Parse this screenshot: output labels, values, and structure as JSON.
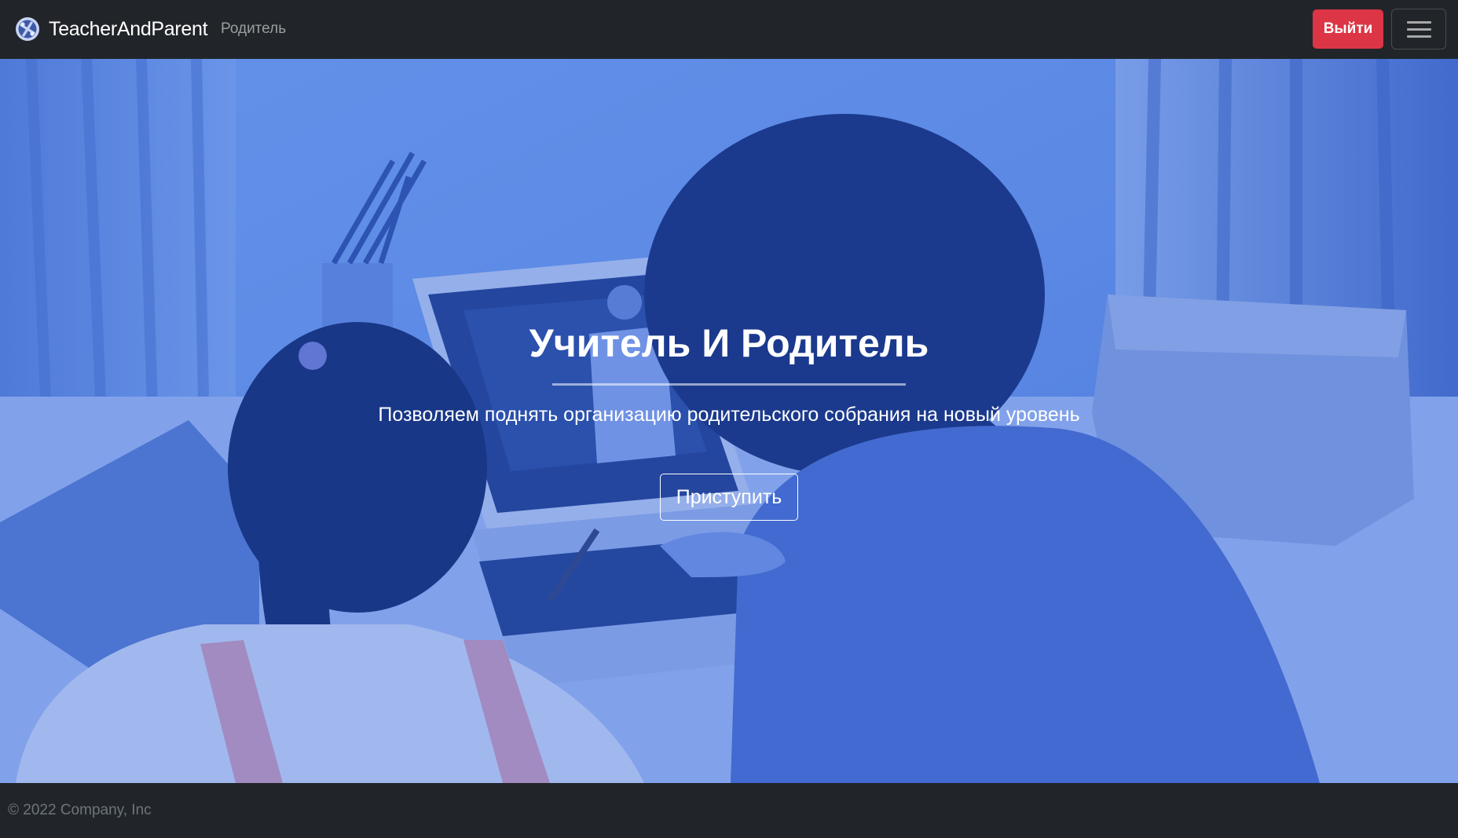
{
  "navbar": {
    "brand_name": "TeacherAndParent",
    "logo_icon": "brand-logo-icon",
    "role_link": "Родитель",
    "logout_label": "Выйти",
    "menu_icon": "hamburger-menu-icon"
  },
  "hero": {
    "title": "Учитель И Родитель",
    "subtitle": "Позволяем поднять организацию родительского собрания на новый уровень",
    "cta_label": "Приступить",
    "overlay_color": "#3d6ee8"
  },
  "footer": {
    "copyright": "© 2022 Company, Inc"
  },
  "colors": {
    "navbar_bg": "#212529",
    "logout_bg": "#dc3545",
    "footer_text": "#6c757d"
  }
}
